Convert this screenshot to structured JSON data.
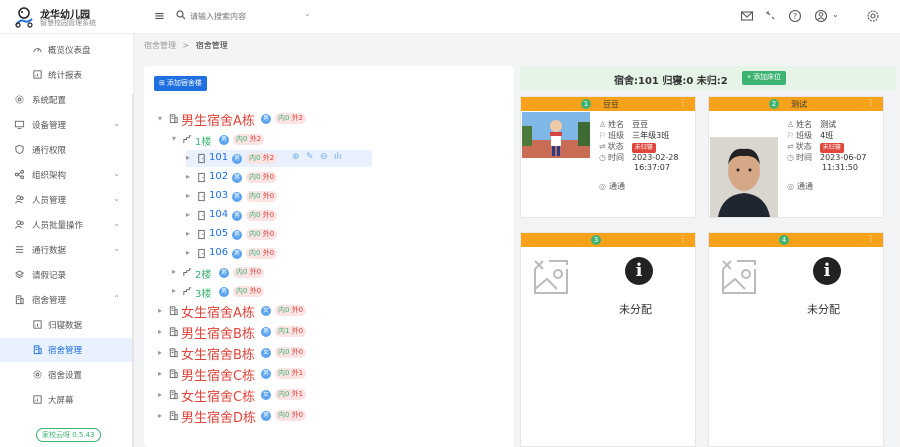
{
  "brand": {
    "title": "龙华幼儿园",
    "subtitle": "智慧校园管理系统"
  },
  "search": {
    "placeholder": "请输入搜索内容"
  },
  "sidebar": {
    "items": [
      {
        "label": "概览仪表盘",
        "icon": "gauge-icon",
        "sub": true
      },
      {
        "label": "统计报表",
        "icon": "report-icon",
        "sub": true
      },
      {
        "label": "系统配置",
        "icon": "gear-icon",
        "sub": false
      },
      {
        "label": "设备管理",
        "icon": "monitor-icon",
        "sub": false,
        "arrow": "⌄"
      },
      {
        "label": "通行权限",
        "icon": "shield-icon",
        "sub": false
      },
      {
        "label": "组织架构",
        "icon": "org-icon",
        "sub": false,
        "arrow": "⌄"
      },
      {
        "label": "人员管理",
        "icon": "users-icon",
        "sub": false,
        "arrow": "⌄"
      },
      {
        "label": "人员批量操作",
        "icon": "users-icon",
        "sub": false,
        "arrow": "⌄"
      },
      {
        "label": "通行数据",
        "icon": "list-icon",
        "sub": false,
        "arrow": "⌄"
      },
      {
        "label": "请假记录",
        "icon": "layers-icon",
        "sub": false
      },
      {
        "label": "宿舍管理",
        "icon": "building-icon",
        "sub": false,
        "arrow": "⌃"
      },
      {
        "label": "归寝数据",
        "icon": "report-icon",
        "sub": true
      },
      {
        "label": "宿舍管理",
        "icon": "building-icon",
        "sub": true,
        "active": true
      },
      {
        "label": "宿舍设置",
        "icon": "gear-icon",
        "sub": true
      },
      {
        "label": "大屏幕",
        "icon": "report-icon",
        "sub": true
      }
    ],
    "version": "家校云呀 0.5.43"
  },
  "breadcrumb": {
    "parent": "宿舍管理",
    "sep": ">",
    "current": "宿舍管理"
  },
  "tree": {
    "add_button": "添加宿舍楼",
    "sex_male": "男",
    "sex_female": "女",
    "in_label": "内",
    "out_label": "外",
    "nodes": [
      {
        "kind": "bldg",
        "label": "男生宿舍A栋",
        "sex": "男",
        "in": "0",
        "out": "2",
        "open": true
      },
      {
        "kind": "floor",
        "label": "1楼",
        "sex": "男",
        "in": "0",
        "out": "2",
        "open": true
      },
      {
        "kind": "room",
        "label": "101",
        "sex": "男",
        "in": "0",
        "out": "2",
        "selected": true
      },
      {
        "kind": "room",
        "label": "102",
        "sex": "男",
        "in": "0",
        "out": "0"
      },
      {
        "kind": "room",
        "label": "103",
        "sex": "男",
        "in": "0",
        "out": "0"
      },
      {
        "kind": "room",
        "label": "104",
        "sex": "男",
        "in": "0",
        "out": "0"
      },
      {
        "kind": "room",
        "label": "105",
        "sex": "男",
        "in": "0",
        "out": "0"
      },
      {
        "kind": "room",
        "label": "106",
        "sex": "男",
        "in": "0",
        "out": "0"
      },
      {
        "kind": "floor",
        "label": "2楼",
        "sex": "男",
        "in": "0",
        "out": "0"
      },
      {
        "kind": "floor",
        "label": "3楼",
        "sex": "男",
        "in": "0",
        "out": "0"
      },
      {
        "kind": "bldg",
        "label": "女生宿舍A栋",
        "sex": "女",
        "in": "0",
        "out": "0"
      },
      {
        "kind": "bldg",
        "label": "男生宿舍B栋",
        "sex": "男",
        "in": "1",
        "out": "0"
      },
      {
        "kind": "bldg",
        "label": "女生宿舍B栋",
        "sex": "女",
        "in": "0",
        "out": "0"
      },
      {
        "kind": "bldg",
        "label": "男生宿舍C栋",
        "sex": "男",
        "in": "0",
        "out": "1"
      },
      {
        "kind": "bldg",
        "label": "女生宿舍C栋",
        "sex": "女",
        "in": "0",
        "out": "1"
      },
      {
        "kind": "bldg",
        "label": "男生宿舍D栋",
        "sex": "男",
        "in": "0",
        "out": "0"
      }
    ]
  },
  "room_summary": {
    "text": "宿舍:101  归寝:0  未归:2",
    "add_bed": "+ 添加床位"
  },
  "beds": [
    {
      "num": "1",
      "name": "豆豆",
      "fields": [
        {
          "k": "姓名",
          "v": "豆豆"
        },
        {
          "k": "班级",
          "v": "三年级3班"
        },
        {
          "k": "状态",
          "v": "未归寝",
          "tag": true
        },
        {
          "k": "时间",
          "v": "2023-02-28"
        },
        {
          "k": "",
          "v": "16:37:07"
        }
      ],
      "pass": "通通"
    },
    {
      "num": "2",
      "name": "测试",
      "fields": [
        {
          "k": "姓名",
          "v": "测试"
        },
        {
          "k": "班级",
          "v": "4班"
        },
        {
          "k": "状态",
          "v": "未归寝",
          "tag": true
        },
        {
          "k": "时间",
          "v": "2023-06-07"
        },
        {
          "k": "",
          "v": "11:31:50"
        }
      ],
      "pass": "通通"
    },
    {
      "num": "3",
      "unassigned": "未分配"
    },
    {
      "num": "4",
      "unassigned": "未分配"
    }
  ],
  "colors": {
    "accent": "#1e6fe0",
    "orange": "#f7a21b",
    "green": "#3cb371",
    "red": "#e0463c"
  }
}
